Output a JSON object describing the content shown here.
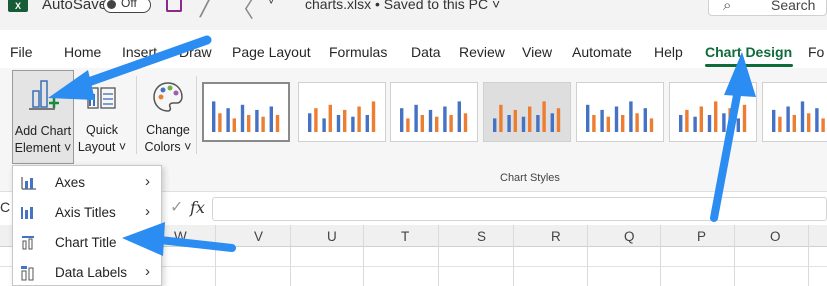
{
  "title_bar": {
    "app_logo": "X",
    "autosave_label": "AutoSave",
    "autosave_state": "Off",
    "document_title": "charts.xlsx • Saved to this PC ˅",
    "search_placeholder": "Search"
  },
  "ribbon_tabs": [
    {
      "label": "File"
    },
    {
      "label": "Home"
    },
    {
      "label": "Insert"
    },
    {
      "label": "Draw"
    },
    {
      "label": "Page Layout"
    },
    {
      "label": "Formulas"
    },
    {
      "label": "Data"
    },
    {
      "label": "Review"
    },
    {
      "label": "View"
    },
    {
      "label": "Automate"
    },
    {
      "label": "Help"
    },
    {
      "label": "Chart Design"
    },
    {
      "label": "Fo"
    }
  ],
  "active_tab": "Chart Design",
  "ribbon": {
    "add_chart_element": "Add Chart Element ˅",
    "add_chart_line1": "Add Chart",
    "add_chart_line2": "Element ˅",
    "quick_layout_line1": "Quick",
    "quick_layout_line2": "Layout ˅",
    "change_colors_line1": "Change",
    "change_colors_line2": "Colors ˅",
    "chart_styles_group_label": "Chart Styles"
  },
  "formula_bar": {
    "name_box_fragment": "C",
    "fx_label": "fx",
    "value": ""
  },
  "column_headers": [
    "W",
    "V",
    "U",
    "T",
    "S",
    "R",
    "Q",
    "P",
    "O"
  ],
  "dropdown_menu": {
    "items": [
      {
        "label": "Axes",
        "has_submenu": true,
        "icon": "axes-icon"
      },
      {
        "label": "Axis Titles",
        "has_submenu": true,
        "icon": "axis-titles-icon"
      },
      {
        "label": "Chart Title",
        "has_submenu": false,
        "icon": "chart-title-icon"
      },
      {
        "label": "Data Labels",
        "has_submenu": true,
        "icon": "data-labels-icon"
      }
    ],
    "submenu_glyph": "›"
  },
  "colors": {
    "accent_green": "#0e6b3a",
    "annotation_arrow": "#2b8cf2",
    "chart_bar_blue": "#4472c4",
    "chart_bar_orange": "#ed7d31"
  }
}
